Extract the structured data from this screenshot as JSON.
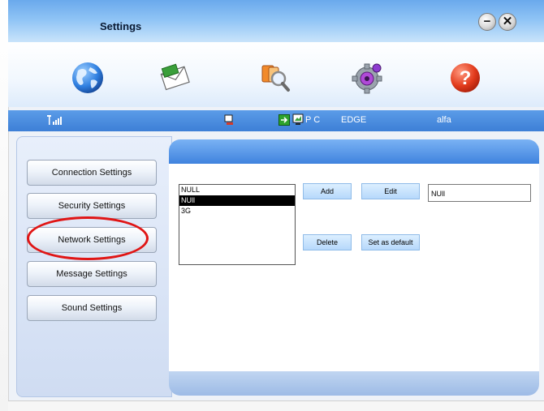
{
  "window": {
    "title": "Settings",
    "minimize_symbol": "−",
    "close_symbol": "✕"
  },
  "toolbar": {
    "items": [
      {
        "icon": "globe-icon",
        "color": "#1f6fd1"
      },
      {
        "icon": "envelope-icon",
        "color": "#3a9f3a"
      },
      {
        "icon": "phonebook-search-icon",
        "color": "#d9822b"
      },
      {
        "icon": "gear-settings-icon",
        "color": "#9a3bd3"
      },
      {
        "icon": "help-icon",
        "color": "#e23b1c"
      }
    ]
  },
  "statusbar": {
    "mode_text": "P C",
    "network_type": "EDGE",
    "operator": "alfa"
  },
  "sidebar": {
    "items": [
      {
        "label": "Connection Settings"
      },
      {
        "label": "Security Settings"
      },
      {
        "label": "Network Settings"
      },
      {
        "label": "Message Settings"
      },
      {
        "label": "Sound Settings"
      }
    ]
  },
  "profiles": {
    "items": [
      "NULL",
      "NUll",
      "3G"
    ],
    "selected": "NUll"
  },
  "actions": {
    "add": "Add",
    "edit": "Edit",
    "delete": "Delete",
    "set_default": "Set as default"
  },
  "edit_field": {
    "value": "NUll"
  },
  "colors": {
    "accent_blue": "#3f83de",
    "annotation_red": "#e01515"
  }
}
